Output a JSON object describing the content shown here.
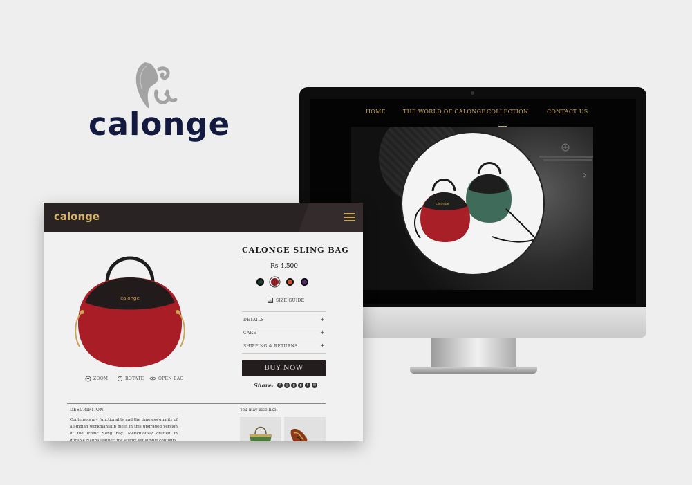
{
  "brand": {
    "wordmark": "calonge",
    "colors": {
      "navy": "#141a3f",
      "gold": "#c9a554",
      "mark_grey": "#a3a3a3"
    }
  },
  "desktop_site": {
    "nav": [
      {
        "label": "HOME"
      },
      {
        "label": "THE WORLD OF CALONGE"
      },
      {
        "label": "COLLECTION",
        "active": true
      },
      {
        "label": "CONTACT US"
      }
    ],
    "hero": {
      "icons": [
        "plus-circle-icon",
        "chevron-right-icon"
      ]
    }
  },
  "product_page": {
    "logo": "calonge",
    "menu_icon": "hamburger-icon",
    "image_tools": [
      {
        "icon": "zoom-plus-icon",
        "label": "ZOOM"
      },
      {
        "icon": "rotate-icon",
        "label": "ROTATE"
      },
      {
        "icon": "eye-icon",
        "label": "OPEN BAG"
      }
    ],
    "title": "CALONGE SLING BAG",
    "price": "Rs 4,500",
    "swatches": [
      {
        "color": "#1f3d33",
        "selected": false
      },
      {
        "color": "#8a1f24",
        "selected": true
      },
      {
        "color": "#c8502a",
        "selected": false
      },
      {
        "color": "#5a2a6e",
        "selected": false
      }
    ],
    "size_guide": "SIZE GUIDE",
    "accordion": [
      {
        "label": "DETAILS",
        "icon": "+"
      },
      {
        "label": "CARE",
        "icon": "+"
      },
      {
        "label": "SHIPPING & RETURNS",
        "icon": "+"
      }
    ],
    "buy_button": "BUY NOW",
    "share_label": "Share:",
    "social": [
      "f",
      "◎",
      "g",
      "p",
      "t",
      "✉"
    ],
    "description_heading": "DESCRIPTION",
    "description": "Contemporary functionality and the timeless quality of all-indian workmanship meet in this upgraded version of the iconic Sling bag. Meticulously crafted in durable Nappa leather, the sturdy yet supple contours",
    "also_like_label": "You may also like:"
  }
}
